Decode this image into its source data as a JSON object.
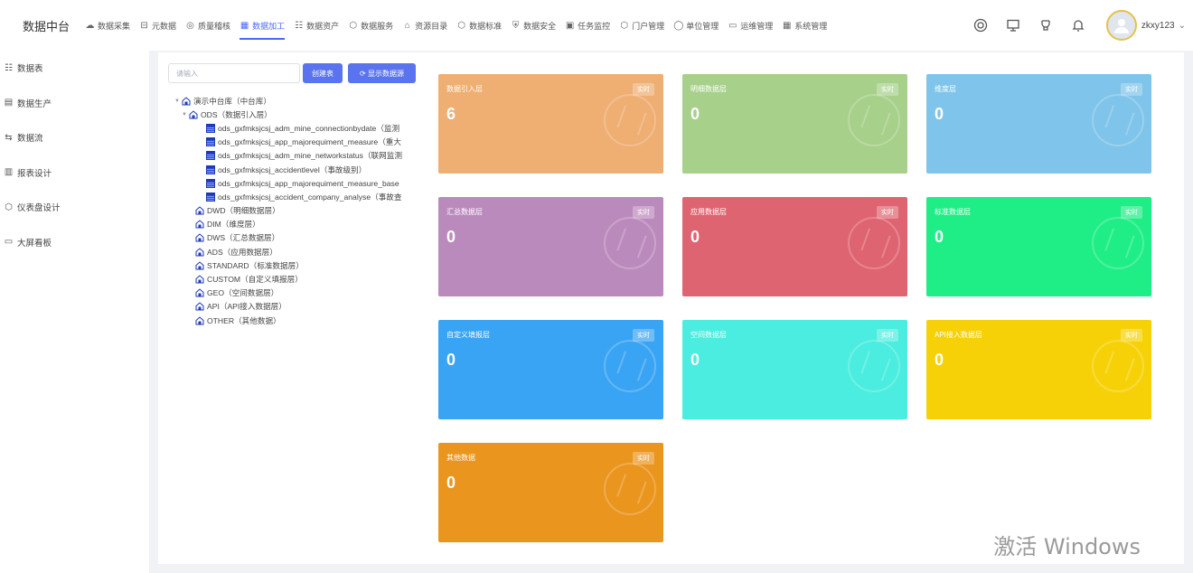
{
  "brand": "数据中台",
  "nav": [
    {
      "label": "数据采集",
      "icon": "cloud-icon"
    },
    {
      "label": "元数据",
      "icon": "database-icon"
    },
    {
      "label": "质量稽核",
      "icon": "target-icon"
    },
    {
      "label": "数据加工",
      "icon": "grid-icon",
      "active": true
    },
    {
      "label": "数据资产",
      "icon": "list-icon"
    },
    {
      "label": "数据服务",
      "icon": "hexagon-icon"
    },
    {
      "label": "资源目录",
      "icon": "bank-icon"
    },
    {
      "label": "数据标准",
      "icon": "hexagon-icon"
    },
    {
      "label": "数据安全",
      "icon": "shield-icon"
    },
    {
      "label": "任务监控",
      "icon": "monitor-icon"
    },
    {
      "label": "门户管理",
      "icon": "hexagon-icon"
    },
    {
      "label": "单位管理",
      "icon": "circle-icon"
    },
    {
      "label": "运维管理",
      "icon": "screen-icon"
    },
    {
      "label": "系统管理",
      "icon": "grid-icon"
    }
  ],
  "user": {
    "name": "zkxy123"
  },
  "sidebar": [
    {
      "label": "数据表",
      "icon": "list-icon"
    },
    {
      "label": "数据生产",
      "icon": "card-icon"
    },
    {
      "label": "数据流",
      "icon": "flow-icon"
    },
    {
      "label": "报表设计",
      "icon": "bar-chart-icon"
    },
    {
      "label": "仪表盘设计",
      "icon": "hexagon-icon"
    },
    {
      "label": "大屏看板",
      "icon": "screen-icon"
    }
  ],
  "toolbar": {
    "search_placeholder": "请输入",
    "create_label": "创建表",
    "show_label": "显示数据源"
  },
  "tree": {
    "root": "演示中台库（中台库）",
    "ods": "ODS（数据引入层）",
    "ods_tables": [
      "ods_gxfmksjcsj_adm_mine_connectionbydate（监测",
      "ods_gxfmksjcsj_app_majorequiment_measure（重大",
      "ods_gxfmksjcsj_adm_mine_networkstatus（联网监测",
      "ods_gxfmksjcsj_accidentlevel（事故级别）",
      "ods_gxfmksjcsj_app_majorequiment_measure_base",
      "ods_gxfmksjcsj_accident_company_analyse（事故查"
    ],
    "layers": [
      "DWD（明细数据层）",
      "DIM（维度层）",
      "DWS（汇总数据层）",
      "ADS（应用数据层）",
      "STANDARD（标准数据层）",
      "CUSTOM（自定义填报层）",
      "GEO（空间数据层）",
      "API（API接入数据层）",
      "OTHER（其他数据）"
    ]
  },
  "badge_label": "实时",
  "cards": [
    {
      "title": "数据引入层",
      "value": "6",
      "color": "#efae72"
    },
    {
      "title": "明细数据层",
      "value": "0",
      "color": "#a7d08b"
    },
    {
      "title": "维度层",
      "value": "0",
      "color": "#7fc4ea"
    },
    {
      "title": "汇总数据层",
      "value": "0",
      "color": "#bb8abd"
    },
    {
      "title": "应用数据层",
      "value": "0",
      "color": "#df6471"
    },
    {
      "title": "标准数据层",
      "value": "0",
      "color": "#1fee86"
    },
    {
      "title": "自定义填报层",
      "value": "0",
      "color": "#3aa4f4"
    },
    {
      "title": "空间数据层",
      "value": "0",
      "color": "#4aeddf"
    },
    {
      "title": "API接入数据层",
      "value": "0",
      "color": "#f7d108"
    },
    {
      "title": "其他数据",
      "value": "0",
      "color": "#ea951e"
    }
  ],
  "watermark": "激活 Windows"
}
